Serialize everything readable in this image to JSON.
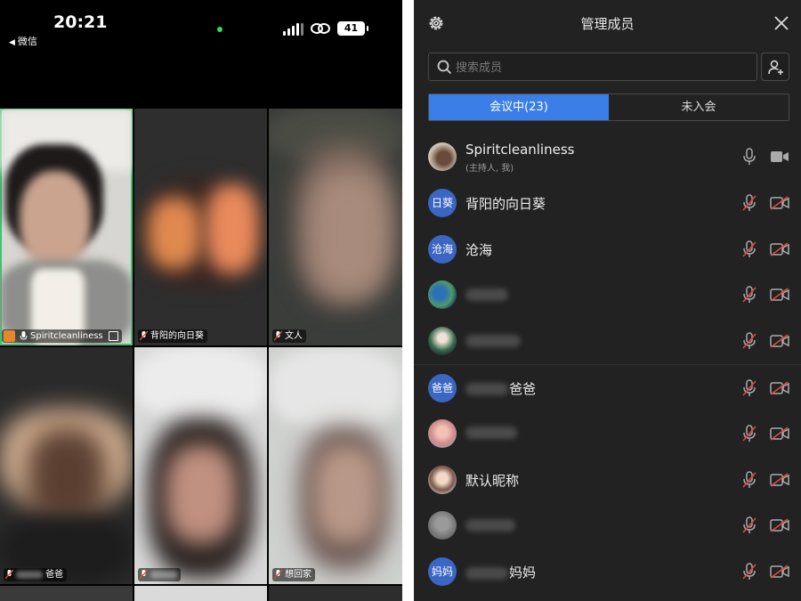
{
  "phone": {
    "time": "20:21",
    "back_label": "微信",
    "battery": "41",
    "tiles": [
      {
        "label": "Spiritcleanliness",
        "active": true
      },
      {
        "label": "背阳的向日葵"
      },
      {
        "label": "文人"
      },
      {
        "label": "爸爸"
      },
      {
        "label": ""
      },
      {
        "label": "想回家"
      }
    ]
  },
  "panel": {
    "title": "管理成员",
    "search_placeholder": "搜索成员",
    "tabs": [
      {
        "label": "会议中(23)",
        "active": true
      },
      {
        "label": "未入会"
      }
    ],
    "members": [
      {
        "name": "Spiritcleanliness",
        "sub": "(主持人, 我)",
        "avatar": "photo",
        "mic": "on",
        "cam": "on"
      },
      {
        "name": "背阳的向日葵",
        "avatar_text": "日葵",
        "mic": "muted",
        "cam": "off"
      },
      {
        "name": "沧海",
        "avatar_text": "沧海",
        "mic": "muted",
        "cam": "off"
      },
      {
        "name": "",
        "avatar": "photo",
        "mic": "muted",
        "cam": "off"
      },
      {
        "name": "",
        "avatar": "photo",
        "mic": "muted",
        "cam": "off"
      },
      {
        "name": "爸爸",
        "avatar_text": "爸爸",
        "mic": "muted",
        "cam": "off"
      },
      {
        "name": "",
        "avatar": "photo",
        "mic": "muted",
        "cam": "off"
      },
      {
        "name": "默认昵称",
        "avatar": "photo",
        "mic": "muted",
        "cam": "off"
      },
      {
        "name": "",
        "avatar": "photo",
        "mic": "muted",
        "cam": "off"
      },
      {
        "name": "妈妈",
        "avatar_text": "妈妈",
        "mic": "muted",
        "cam": "off"
      }
    ]
  },
  "colors": {
    "accent": "#3b7ee8",
    "active_border": "#3ec46d",
    "muted_red": "#e04848",
    "avatar_blue": "#3b66c4",
    "panel_bg": "#222222"
  }
}
